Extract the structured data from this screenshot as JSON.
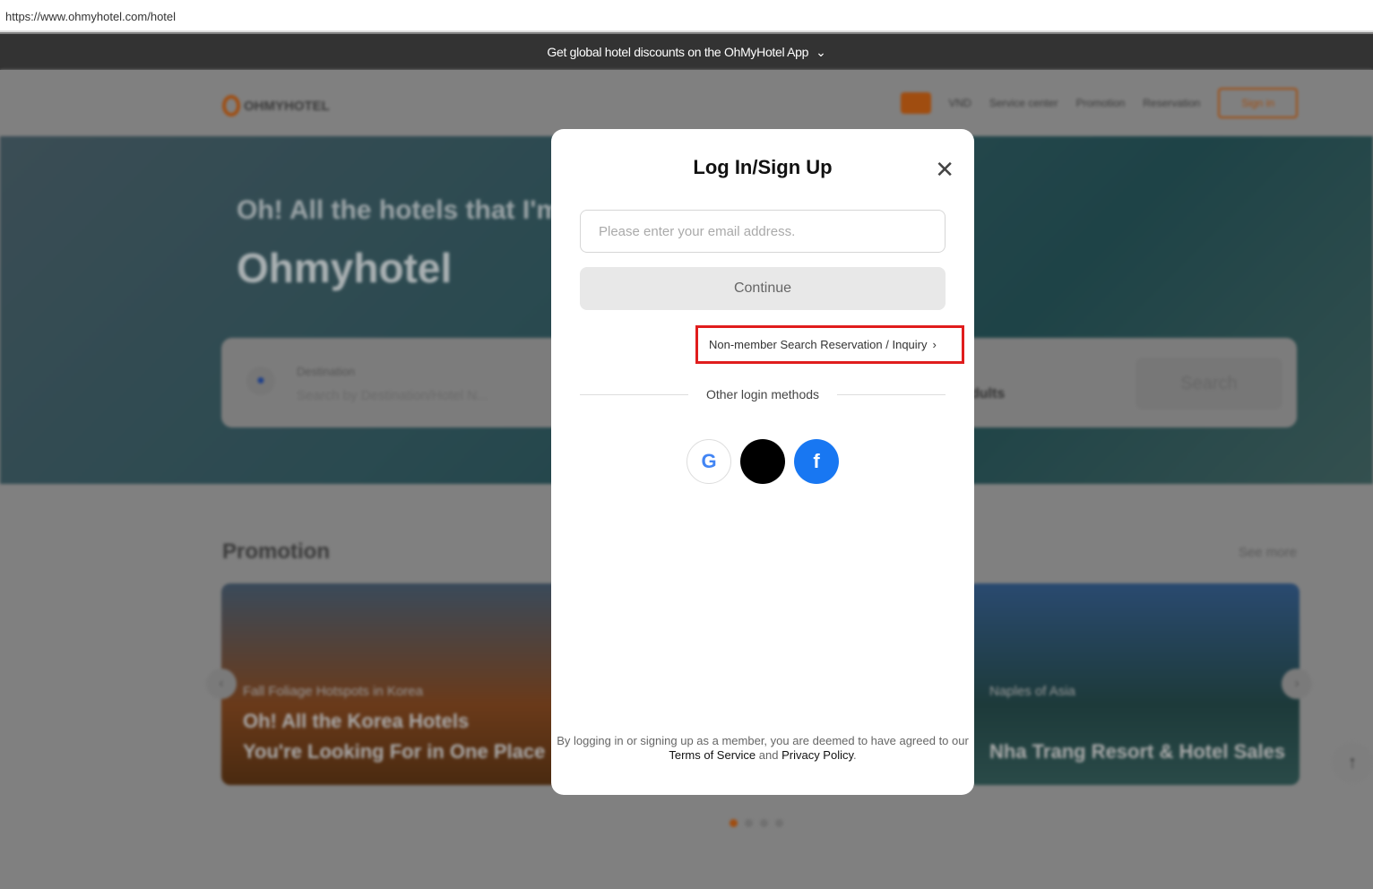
{
  "browser": {
    "url": "https://www.ohmyhotel.com/hotel"
  },
  "banner": {
    "text": "Get global hotel discounts on the OhMyHotel App"
  },
  "header": {
    "logo": "OHMYHOTEL",
    "currency": "VND",
    "nav": [
      "Service center",
      "Promotion",
      "Reservation"
    ],
    "sign_in": "Sign in"
  },
  "hero": {
    "subtitle": "Oh! All the hotels that I'm",
    "title": "Ohmyhotel"
  },
  "search": {
    "destination_label": "Destination",
    "destination_placeholder": "Search by Destination/Hotel N...",
    "guests": "dults",
    "button": "Search"
  },
  "promotion": {
    "title": "Promotion",
    "see_more": "See more",
    "cards": [
      {
        "tag": "Fall Foliage Hotspots in Korea",
        "line1": "Oh! All the Korea Hotels",
        "line2": "You're Looking For in One Place"
      },
      {
        "tag": "Naples of Asia",
        "line1": "",
        "line2": "Nha Trang Resort & Hotel Sales"
      }
    ]
  },
  "modal": {
    "title": "Log In/Sign Up",
    "email_placeholder": "Please enter your email address.",
    "email_value": "",
    "continue": "Continue",
    "non_member": "Non-member Search Reservation / Inquiry",
    "other_methods": "Other login methods",
    "social": [
      "google",
      "apple",
      "facebook"
    ],
    "terms_prefix": "By logging in or signing up as a member, you are deemed to have agreed to our ",
    "terms_link": "Terms of Service",
    "terms_and": " and ",
    "privacy_link": "Privacy Policy",
    "terms_suffix": "."
  },
  "colors": {
    "accent": "#e8701a",
    "highlight": "#e01d1d",
    "facebook": "#1877f2"
  }
}
